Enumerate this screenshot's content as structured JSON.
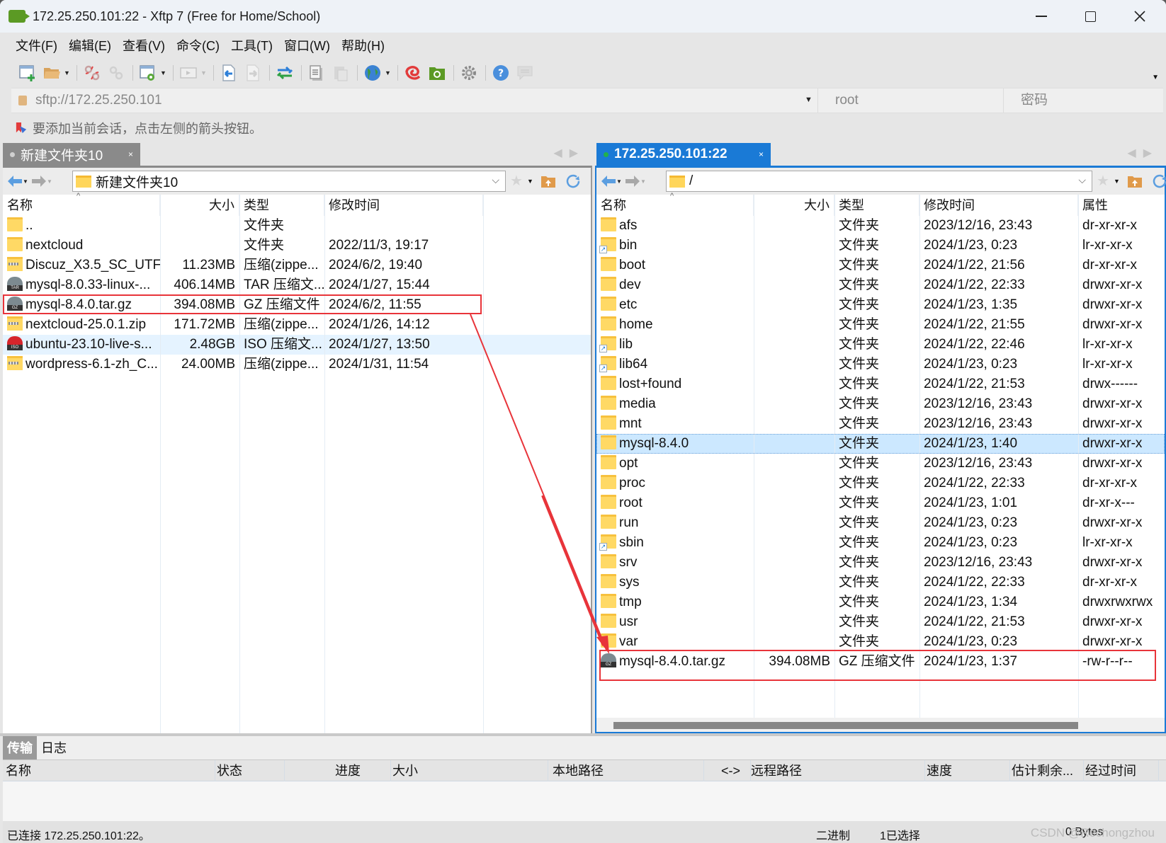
{
  "window": {
    "title": "172.25.250.101:22 - Xftp 7 (Free for Home/School)",
    "controls": {
      "minimize": "minimize",
      "maximize": "maximize",
      "close": "close"
    }
  },
  "menu": {
    "items": [
      {
        "label": "文件(F)"
      },
      {
        "label": "编辑(E)"
      },
      {
        "label": "查看(V)"
      },
      {
        "label": "命令(C)"
      },
      {
        "label": "工具(T)"
      },
      {
        "label": "窗口(W)"
      },
      {
        "label": "帮助(H)"
      }
    ]
  },
  "toolbar": {
    "buttons": [
      {
        "name": "new-session",
        "icon": "new-window-icon"
      },
      {
        "name": "open-session",
        "icon": "folder-open-icon",
        "dropdown": true
      },
      {
        "name": "disconnect",
        "icon": "disconnect-icon"
      },
      {
        "name": "reconnect",
        "icon": "link-icon"
      },
      {
        "name": "session-properties",
        "icon": "window-gear-icon",
        "dropdown": true
      },
      {
        "name": "transfer-mode",
        "icon": "play-box-icon",
        "dropdown": true
      },
      {
        "name": "upload",
        "icon": "file-left-arrow-icon"
      },
      {
        "name": "download",
        "icon": "file-right-arrow-icon"
      },
      {
        "name": "sync",
        "icon": "swap-arrows-icon"
      },
      {
        "name": "copy",
        "icon": "copy-doc-icon"
      },
      {
        "name": "paste",
        "icon": "paste-doc-icon"
      },
      {
        "name": "encoding",
        "icon": "globe-icon",
        "dropdown": true
      },
      {
        "name": "xshell",
        "icon": "xshell-swirl-icon"
      },
      {
        "name": "xftp",
        "icon": "xftp-folder-icon"
      },
      {
        "name": "options",
        "icon": "gear-icon"
      },
      {
        "name": "help",
        "icon": "help-icon"
      },
      {
        "name": "feedback",
        "icon": "chat-bubble-icon"
      }
    ]
  },
  "address": {
    "url": "sftp://172.25.250.101",
    "user_placeholder": "root",
    "password_placeholder": "密码"
  },
  "hint": {
    "text": "要添加当前会话，点击左侧的箭头按钮。"
  },
  "local_pane": {
    "tab_label": "新建文件夹10",
    "path": "新建文件夹10",
    "columns": [
      "名称",
      "大小",
      "类型",
      "修改时间"
    ],
    "rows": [
      {
        "name": "..",
        "size": "",
        "type": "文件夹",
        "modified": "",
        "icon": "folder"
      },
      {
        "name": "nextcloud",
        "size": "",
        "type": "文件夹",
        "modified": "2022/11/3, 19:17",
        "icon": "folder"
      },
      {
        "name": "Discuz_X3.5_SC_UTF...",
        "size": "11.23MB",
        "type": "压缩(zippe...",
        "modified": "2024/6/2, 19:40",
        "icon": "zip"
      },
      {
        "name": "mysql-8.0.33-linux-...",
        "size": "406.14MB",
        "type": "TAR 压缩文...",
        "modified": "2024/1/27, 15:44",
        "icon": "tar"
      },
      {
        "name": "mysql-8.4.0.tar.gz",
        "size": "394.08MB",
        "type": "GZ 压缩文件",
        "modified": "2024/6/2, 11:55",
        "icon": "gz"
      },
      {
        "name": "nextcloud-25.0.1.zip",
        "size": "171.72MB",
        "type": "压缩(zippe...",
        "modified": "2024/1/26, 14:12",
        "icon": "zip"
      },
      {
        "name": "ubuntu-23.10-live-s...",
        "size": "2.48GB",
        "type": "ISO 压缩文...",
        "modified": "2024/1/27, 13:50",
        "icon": "iso"
      },
      {
        "name": "wordpress-6.1-zh_C...",
        "size": "24.00MB",
        "type": "压缩(zippe...",
        "modified": "2024/1/31, 11:54",
        "icon": "zip"
      }
    ]
  },
  "remote_pane": {
    "tab_label": "172.25.250.101:22",
    "status_color": "#22b14c",
    "path": "/",
    "columns": [
      "名称",
      "大小",
      "类型",
      "修改时间",
      "属性"
    ],
    "rows": [
      {
        "name": "afs",
        "size": "",
        "type": "文件夹",
        "modified": "2023/12/16, 23:43",
        "attr": "dr-xr-xr-x",
        "icon": "folder"
      },
      {
        "name": "bin",
        "size": "",
        "type": "文件夹",
        "modified": "2024/1/23, 0:23",
        "attr": "lr-xr-xr-x",
        "icon": "link"
      },
      {
        "name": "boot",
        "size": "",
        "type": "文件夹",
        "modified": "2024/1/22, 21:56",
        "attr": "dr-xr-xr-x",
        "icon": "folder"
      },
      {
        "name": "dev",
        "size": "",
        "type": "文件夹",
        "modified": "2024/1/22, 22:33",
        "attr": "drwxr-xr-x",
        "icon": "folder"
      },
      {
        "name": "etc",
        "size": "",
        "type": "文件夹",
        "modified": "2024/1/23, 1:35",
        "attr": "drwxr-xr-x",
        "icon": "folder"
      },
      {
        "name": "home",
        "size": "",
        "type": "文件夹",
        "modified": "2024/1/22, 21:55",
        "attr": "drwxr-xr-x",
        "icon": "folder"
      },
      {
        "name": "lib",
        "size": "",
        "type": "文件夹",
        "modified": "2024/1/22, 22:46",
        "attr": "lr-xr-xr-x",
        "icon": "link"
      },
      {
        "name": "lib64",
        "size": "",
        "type": "文件夹",
        "modified": "2024/1/23, 0:23",
        "attr": "lr-xr-xr-x",
        "icon": "link"
      },
      {
        "name": "lost+found",
        "size": "",
        "type": "文件夹",
        "modified": "2024/1/22, 21:53",
        "attr": "drwx------",
        "icon": "folder"
      },
      {
        "name": "media",
        "size": "",
        "type": "文件夹",
        "modified": "2023/12/16, 23:43",
        "attr": "drwxr-xr-x",
        "icon": "folder"
      },
      {
        "name": "mnt",
        "size": "",
        "type": "文件夹",
        "modified": "2023/12/16, 23:43",
        "attr": "drwxr-xr-x",
        "icon": "folder"
      },
      {
        "name": "mysql-8.4.0",
        "size": "",
        "type": "文件夹",
        "modified": "2024/1/23, 1:40",
        "attr": "drwxr-xr-x",
        "icon": "folder",
        "selected": true
      },
      {
        "name": "opt",
        "size": "",
        "type": "文件夹",
        "modified": "2023/12/16, 23:43",
        "attr": "drwxr-xr-x",
        "icon": "folder"
      },
      {
        "name": "proc",
        "size": "",
        "type": "文件夹",
        "modified": "2024/1/22, 22:33",
        "attr": "dr-xr-xr-x",
        "icon": "folder"
      },
      {
        "name": "root",
        "size": "",
        "type": "文件夹",
        "modified": "2024/1/23, 1:01",
        "attr": "dr-xr-x---",
        "icon": "folder"
      },
      {
        "name": "run",
        "size": "",
        "type": "文件夹",
        "modified": "2024/1/23, 0:23",
        "attr": "drwxr-xr-x",
        "icon": "folder"
      },
      {
        "name": "sbin",
        "size": "",
        "type": "文件夹",
        "modified": "2024/1/23, 0:23",
        "attr": "lr-xr-xr-x",
        "icon": "link"
      },
      {
        "name": "srv",
        "size": "",
        "type": "文件夹",
        "modified": "2023/12/16, 23:43",
        "attr": "drwxr-xr-x",
        "icon": "folder"
      },
      {
        "name": "sys",
        "size": "",
        "type": "文件夹",
        "modified": "2024/1/22, 22:33",
        "attr": "dr-xr-xr-x",
        "icon": "folder"
      },
      {
        "name": "tmp",
        "size": "",
        "type": "文件夹",
        "modified": "2024/1/23, 1:34",
        "attr": "drwxrwxrwx",
        "icon": "folder"
      },
      {
        "name": "usr",
        "size": "",
        "type": "文件夹",
        "modified": "2024/1/22, 21:53",
        "attr": "drwxr-xr-x",
        "icon": "folder"
      },
      {
        "name": "var",
        "size": "",
        "type": "文件夹",
        "modified": "2024/1/23, 0:23",
        "attr": "drwxr-xr-x",
        "icon": "folder"
      },
      {
        "name": "mysql-8.4.0.tar.gz",
        "size": "394.08MB",
        "type": "GZ 压缩文件",
        "modified": "2024/1/23, 1:37",
        "attr": "-rw-r--r--",
        "icon": "gz"
      }
    ]
  },
  "transfer_panel": {
    "tabs": [
      {
        "label": "传输",
        "active": true
      },
      {
        "label": "日志",
        "active": false
      }
    ],
    "columns": [
      "名称",
      "状态",
      "进度",
      "大小",
      "本地路径",
      "<->",
      "远程路径",
      "速度",
      "估计剩余...",
      "经过时间"
    ]
  },
  "status_bar": {
    "connection": "已连接 172.25.250.101:22。",
    "mode": "二进制",
    "selection": "1已选择",
    "size": "0 Bytes",
    "watermark": "CSDN @Rechongzhou"
  },
  "annotations": {
    "color": "#e8343a"
  }
}
